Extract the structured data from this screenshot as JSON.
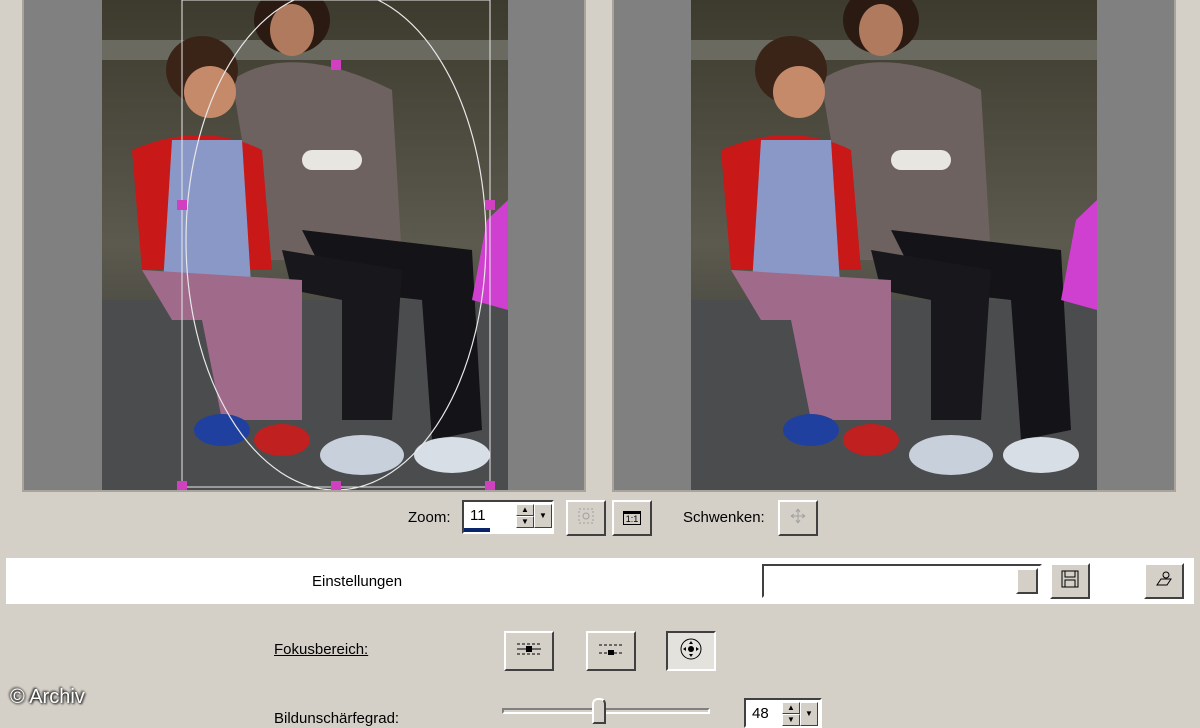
{
  "zoom": {
    "label": "Zoom:",
    "value": "11",
    "one_to_one_label": "1:1"
  },
  "pan": {
    "label": "Schwenken:"
  },
  "settings": {
    "label": "Einstellungen",
    "value": ""
  },
  "focus": {
    "label": "Fokusbereich:"
  },
  "sharpness": {
    "label": "Bildunschärfegrad:",
    "value": "48",
    "level": 48
  },
  "watermark": "© Archiv",
  "icons": {
    "save": "save-icon",
    "load": "load-settings-icon",
    "fit": "fit-view-icon",
    "pan": "pan-icon",
    "focus_horizontal": "focus-horizontal-icon",
    "focus_dashed": "focus-dashed-icon",
    "focus_radial": "focus-radial-icon"
  }
}
